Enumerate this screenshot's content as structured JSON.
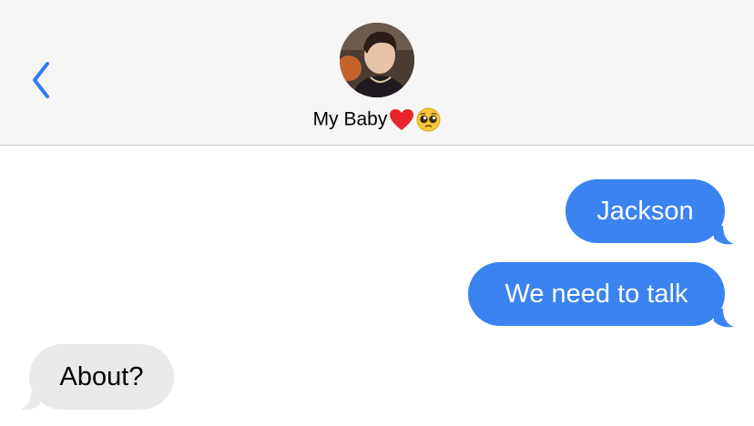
{
  "header": {
    "contact_name": "My Baby",
    "name_emoji_heart": "❤️",
    "name_emoji_face": "🥺",
    "back_icon": "chevron-left-icon",
    "avatar_icon": "contact-photo"
  },
  "messages": [
    {
      "direction": "sent",
      "text": "Jackson"
    },
    {
      "direction": "sent",
      "text": "We need to talk"
    },
    {
      "direction": "received",
      "text": "About?"
    }
  ],
  "colors": {
    "sent_bubble": "#3a83f1",
    "received_bubble": "#e9e9eb",
    "accent": "#2f7cf6",
    "header_bg": "#f6f6f6"
  }
}
